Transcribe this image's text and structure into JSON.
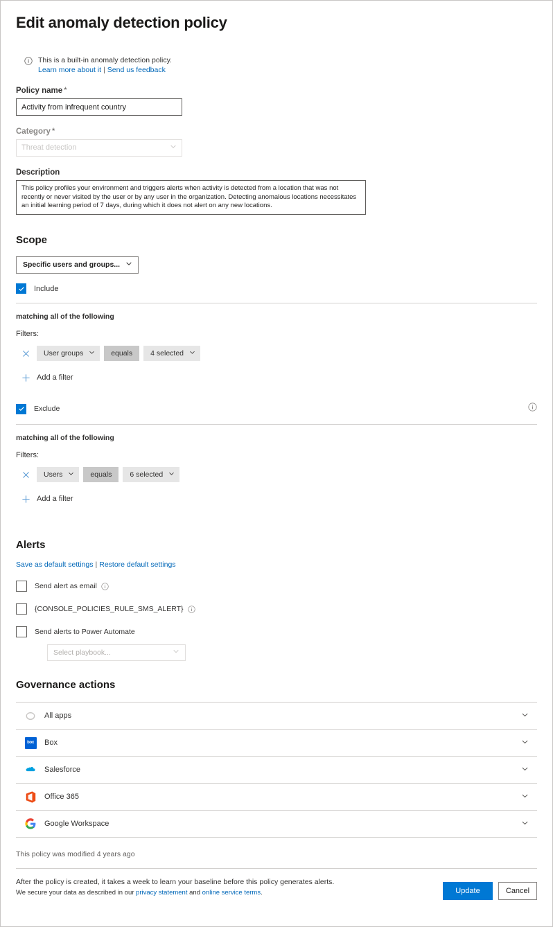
{
  "page": {
    "title": "Edit anomaly detection policy"
  },
  "notice": {
    "icon": "info-circle-icon",
    "text": "This is a built-in anomaly detection policy.",
    "learn_more": "Learn more about it",
    "divider": "|",
    "feedback": "Send us feedback"
  },
  "policy_name": {
    "label": "Policy name",
    "required_mark": "*",
    "value": "Activity from infrequent country",
    "placeholder": "Policy name"
  },
  "category": {
    "label": "Category",
    "required_mark": "*",
    "value": "Threat detection"
  },
  "description": {
    "label": "Description",
    "value": "This policy profiles your environment and triggers alerts when activity is detected from a location that was not recently or never visited by the user or by any user in the organization. Detecting anomalous locations necessitates an initial learning period of 7 days, during which it does not alert on any new locations."
  },
  "scope": {
    "heading": "Scope",
    "selector_value": "Specific users and groups...",
    "include": {
      "label": "Include",
      "checked": true,
      "matching": "matching all of the following",
      "filters_label": "Filters:",
      "filter": {
        "remove_icon": "close-icon",
        "attribute": "User groups",
        "operator": "equals",
        "value": "4 selected"
      },
      "add_filter": "Add a filter"
    },
    "exclude": {
      "label": "Exclude",
      "checked": true,
      "info_icon": "info-circle-icon",
      "matching": "matching all of the following",
      "filters_label": "Filters:",
      "filter": {
        "remove_icon": "close-icon",
        "attribute": "Users",
        "operator": "equals",
        "value": "6 selected"
      },
      "add_filter": "Add a filter"
    }
  },
  "alerts": {
    "heading": "Alerts",
    "save_default": "Save as default settings",
    "divider": "|",
    "restore_default": "Restore default settings",
    "options": [
      {
        "label": "Send alert as email",
        "checked": false,
        "has_info": true
      },
      {
        "label": "{CONSOLE_POLICIES_RULE_SMS_ALERT}",
        "checked": false,
        "has_info": true
      },
      {
        "label": "Send alerts to Power Automate",
        "checked": false,
        "has_info": false
      }
    ],
    "playbook_placeholder": "Select playbook..."
  },
  "governance": {
    "heading": "Governance actions",
    "rows": [
      {
        "name": "All apps",
        "icon": "all-apps-icon",
        "color": "#b3b0ad"
      },
      {
        "name": "Box",
        "icon": "box-icon",
        "color": "#0061d5"
      },
      {
        "name": "Salesforce",
        "icon": "salesforce-icon",
        "color": "#00a1e0"
      },
      {
        "name": "Office 365",
        "icon": "office365-icon",
        "color": "#eb3c00"
      },
      {
        "name": "Google Workspace",
        "icon": "google-workspace-icon",
        "color": "#4285f4"
      }
    ]
  },
  "footer": {
    "modified": "This policy was modified 4 years ago",
    "note": "After the policy is created, it takes a week to learn your baseline before this policy generates alerts.",
    "secure_prefix": "We secure your data as described in our ",
    "privacy_link": "privacy statement",
    "secure_mid": " and ",
    "terms_link": "online service terms",
    "secure_suffix": ".",
    "update_button": "Update",
    "cancel_button": "Cancel"
  },
  "colors": {
    "accent": "#0078d4",
    "link": "#0067b8",
    "chip_bg": "#e6e6e6",
    "chip_op_bg": "#c8c8c8",
    "border": "#d2d0ce"
  }
}
